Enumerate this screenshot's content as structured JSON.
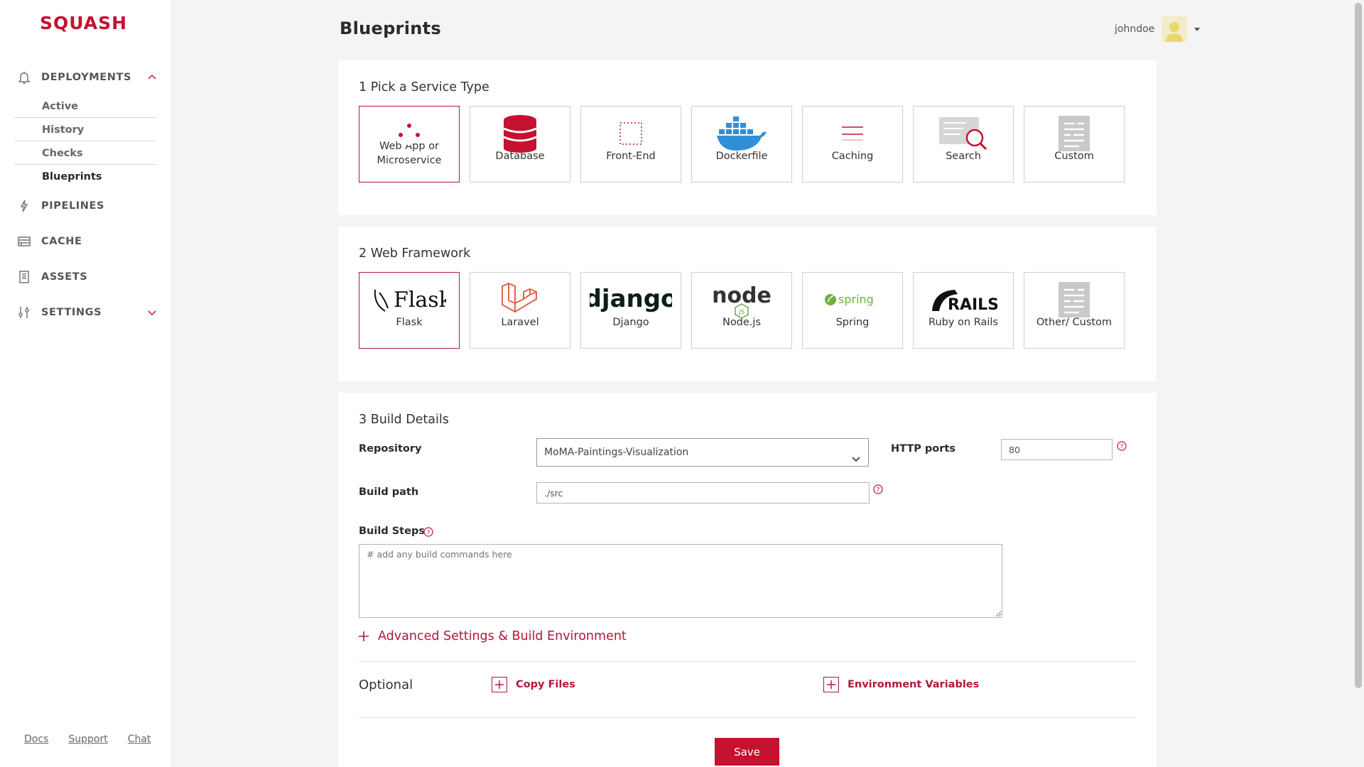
{
  "app": {
    "logo": "SQUASH",
    "brand_color": "#c4122f",
    "page_title": "Blueprints",
    "user": {
      "name": "johndoe"
    }
  },
  "sidebar": {
    "deployments": {
      "label": "DEPLOYMENTS",
      "icon": "bell-icon",
      "items": [
        {
          "label": "Active"
        },
        {
          "label": "History"
        },
        {
          "label": "Checks"
        },
        {
          "label": "Blueprints"
        }
      ]
    },
    "pipelines": {
      "label": "PIPELINES",
      "icon": "bolt-icon"
    },
    "cache": {
      "label": "CACHE",
      "icon": "cache-icon"
    },
    "assets": {
      "label": "ASSETS",
      "icon": "document-icon"
    },
    "settings": {
      "label": "SETTINGS",
      "icon": "sliders-icon"
    },
    "footer": [
      "Docs",
      "Support",
      "Chat"
    ]
  },
  "service_type": {
    "title": "1 Pick a Service Type",
    "options": [
      {
        "label": "Web App or Microservice",
        "icon": "microservice-icon"
      },
      {
        "label": "Database",
        "icon": "database-icon"
      },
      {
        "label": "Front-End",
        "icon": "frontend-icon"
      },
      {
        "label": "Dockerfile",
        "icon": "docker-icon"
      },
      {
        "label": "Caching",
        "icon": "caching-icon"
      },
      {
        "label": "Search",
        "icon": "search-icon"
      },
      {
        "label": "Custom",
        "icon": "custom-icon"
      }
    ]
  },
  "framework": {
    "title": "2 Web Framework",
    "options": [
      {
        "label": "Flask",
        "logo_text": "Flask",
        "icon": "flask-logo"
      },
      {
        "label": "Laravel",
        "icon": "laravel-logo"
      },
      {
        "label": "Django",
        "logo_text": "django",
        "icon": "django-logo"
      },
      {
        "label": "Node.js",
        "logo_text": "node",
        "logo_sub": "JS",
        "icon": "nodejs-logo"
      },
      {
        "label": "Spring",
        "logo_text": "spring",
        "icon": "spring-logo"
      },
      {
        "label": "Ruby on Rails",
        "logo_text": "RAILS",
        "icon": "rails-logo"
      },
      {
        "label": "Other/ Custom",
        "icon": "custom-icon"
      }
    ]
  },
  "build": {
    "title": "3 Build Details",
    "repository_label": "Repository",
    "repository_value": "MoMA-Paintings-Visualization",
    "http_ports_label": "HTTP ports",
    "http_ports_value": "80",
    "build_path_label": "Build path",
    "build_path_value": "./src",
    "build_steps_label": "Build Steps",
    "build_steps_placeholder": "# add any build commands here",
    "advanced_label": "Advanced Settings & Build Environment",
    "optional_label": "Optional",
    "copy_files_label": "Copy Files",
    "env_vars_label": "Environment Variables",
    "save_label": "Save"
  }
}
